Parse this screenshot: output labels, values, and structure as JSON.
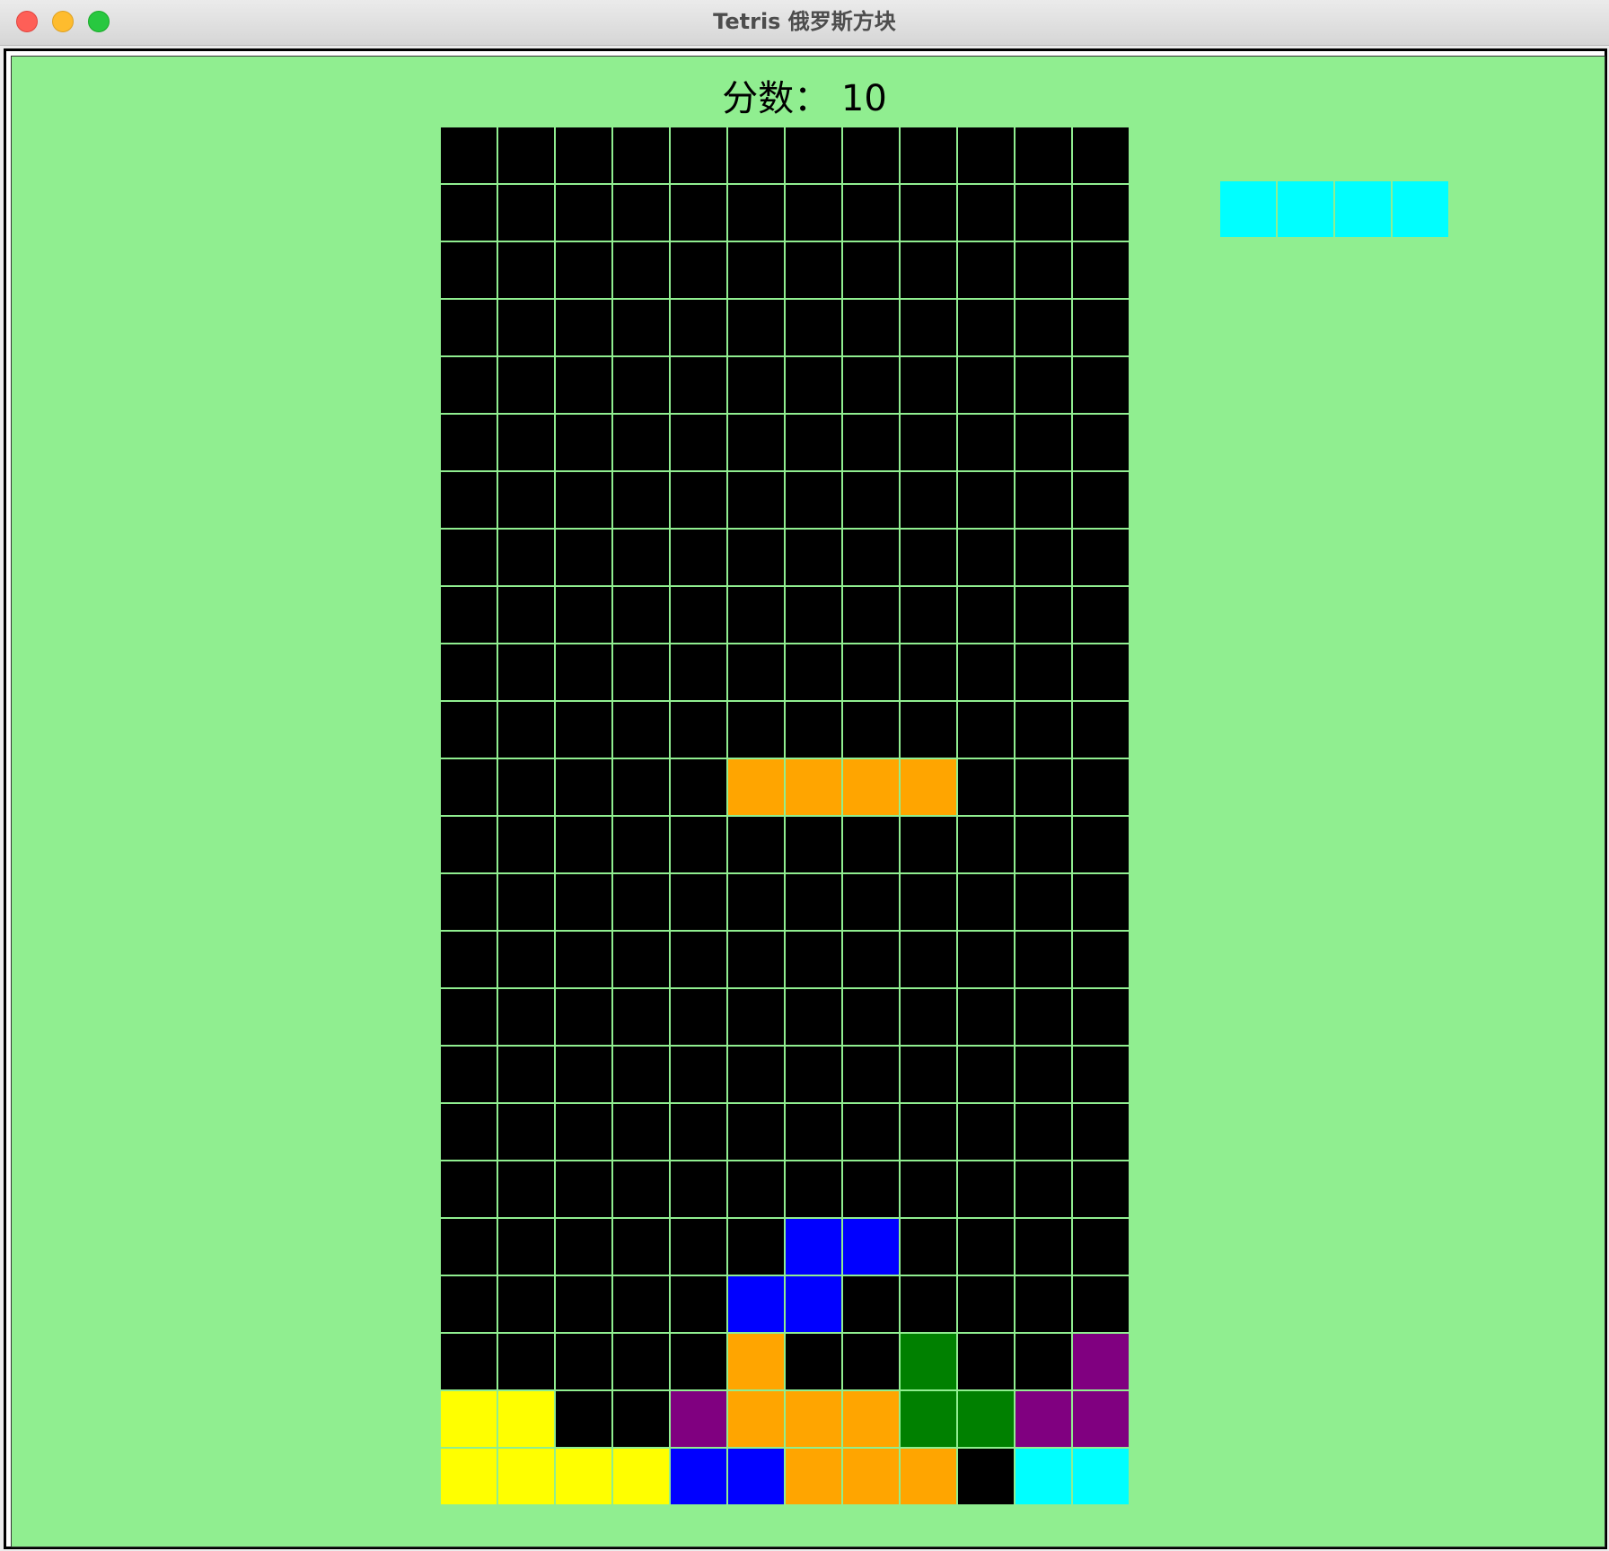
{
  "window": {
    "title": "Tetris 俄罗斯方块"
  },
  "score": {
    "label": "分数：",
    "value": 10,
    "display": "分数： 10"
  },
  "colors": {
    "background": "#90ee90",
    "board_bg": "#000000",
    "grid_line": "#90ee90",
    "palette": {
      ".": "#000000",
      "O": "#ffa500",
      "B": "#0000ff",
      "Y": "#ffff00",
      "P": "#800080",
      "G": "#008000",
      "C": "#00ffff"
    }
  },
  "board": {
    "cols": 12,
    "rows": 24,
    "cells": [
      "............",
      "............",
      "............",
      "............",
      "............",
      "............",
      "............",
      "............",
      "............",
      "............",
      "............",
      ".....OOOO...",
      "............",
      "............",
      "............",
      "............",
      "............",
      "............",
      "............",
      "......BB....",
      ".....BB.....",
      ".....O..G..P",
      "YY..POOOGGPP",
      "YYYYBBOOO.CC"
    ]
  },
  "next_piece": {
    "cells": [
      "CCCC"
    ]
  }
}
